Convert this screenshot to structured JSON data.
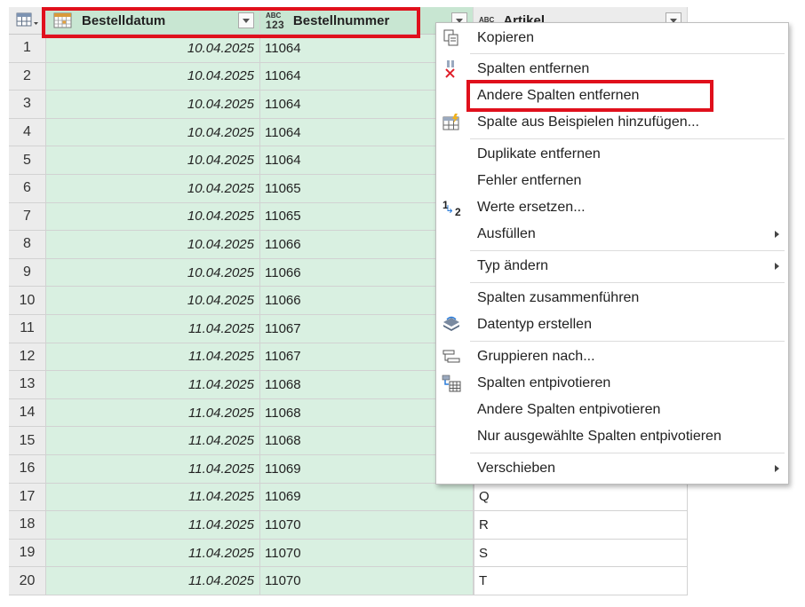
{
  "columns": {
    "col1": {
      "label": "Bestelldatum",
      "type_icon": "calendar-icon"
    },
    "col2": {
      "label": "Bestellnummer",
      "type_top": "ABC",
      "type_bottom": "123"
    },
    "col3": {
      "label": "Artikel",
      "type_top": "ABC"
    }
  },
  "rows": [
    {
      "n": "1",
      "date": "10.04.2025",
      "num": "11064",
      "art": ""
    },
    {
      "n": "2",
      "date": "10.04.2025",
      "num": "11064",
      "art": ""
    },
    {
      "n": "3",
      "date": "10.04.2025",
      "num": "11064",
      "art": ""
    },
    {
      "n": "4",
      "date": "10.04.2025",
      "num": "11064",
      "art": ""
    },
    {
      "n": "5",
      "date": "10.04.2025",
      "num": "11064",
      "art": ""
    },
    {
      "n": "6",
      "date": "10.04.2025",
      "num": "11065",
      "art": ""
    },
    {
      "n": "7",
      "date": "10.04.2025",
      "num": "11065",
      "art": ""
    },
    {
      "n": "8",
      "date": "10.04.2025",
      "num": "11066",
      "art": ""
    },
    {
      "n": "9",
      "date": "10.04.2025",
      "num": "11066",
      "art": ""
    },
    {
      "n": "10",
      "date": "10.04.2025",
      "num": "11066",
      "art": ""
    },
    {
      "n": "11",
      "date": "11.04.2025",
      "num": "11067",
      "art": ""
    },
    {
      "n": "12",
      "date": "11.04.2025",
      "num": "11067",
      "art": ""
    },
    {
      "n": "13",
      "date": "11.04.2025",
      "num": "11068",
      "art": ""
    },
    {
      "n": "14",
      "date": "11.04.2025",
      "num": "11068",
      "art": ""
    },
    {
      "n": "15",
      "date": "11.04.2025",
      "num": "11068",
      "art": ""
    },
    {
      "n": "16",
      "date": "11.04.2025",
      "num": "11069",
      "art": ""
    },
    {
      "n": "17",
      "date": "11.04.2025",
      "num": "11069",
      "art": "Q"
    },
    {
      "n": "18",
      "date": "11.04.2025",
      "num": "11070",
      "art": "R"
    },
    {
      "n": "19",
      "date": "11.04.2025",
      "num": "11070",
      "art": "S"
    },
    {
      "n": "20",
      "date": "11.04.2025",
      "num": "11070",
      "art": "T"
    }
  ],
  "menu": {
    "copy": "Kopieren",
    "remove_cols": "Spalten entfernen",
    "remove_other": "Andere Spalten entfernen",
    "add_from_examples": "Spalte aus Beispielen hinzufügen...",
    "remove_duplicates": "Duplikate entfernen",
    "remove_errors": "Fehler entfernen",
    "replace_values": "Werte ersetzen...",
    "fill": "Ausfüllen",
    "change_type": "Typ ändern",
    "merge_cols": "Spalten zusammenführen",
    "create_datatype": "Datentyp erstellen",
    "group_by": "Gruppieren nach...",
    "unpivot": "Spalten entpivotieren",
    "unpivot_other": "Andere Spalten entpivotieren",
    "unpivot_selected": "Nur ausgewählte Spalten entpivotieren",
    "move": "Verschieben",
    "replace_icon_top": "1",
    "replace_icon_bottom": "2"
  },
  "colors": {
    "highlight": "#e0101c",
    "selected_col": "#d9f0e1"
  }
}
